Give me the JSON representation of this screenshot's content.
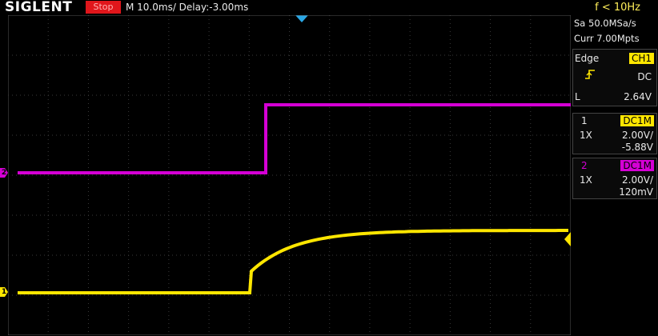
{
  "brand": "SIGLENT",
  "status": "Stop",
  "timebase": "M 10.0ms/ Delay:-3.00ms",
  "frequency": "f < 10Hz",
  "acquisition": {
    "sample_rate": "Sa 50.0MSa/s",
    "memory_depth": "Curr 7.00Mpts"
  },
  "trigger": {
    "label": "Edge",
    "source": "CH1",
    "slope_icon": "rising-edge-icon",
    "coupling": "DC",
    "level_label": "L",
    "level": "2.64V"
  },
  "channels": [
    {
      "number": "1",
      "coupling": "DC1M",
      "probe": "1X",
      "scale": "2.00V/",
      "offset": "-5.88V",
      "color": "#ffe600"
    },
    {
      "number": "2",
      "coupling": "DC1M",
      "probe": "1X",
      "scale": "2.00V/",
      "offset": "120mV",
      "color": "#d500d5"
    }
  ],
  "colors": {
    "ch1": "#ffe600",
    "ch2": "#d500d5",
    "stop": "#e0161b",
    "trigger_marker": "#2aa7e6",
    "frequency": "#ffef5a"
  }
}
